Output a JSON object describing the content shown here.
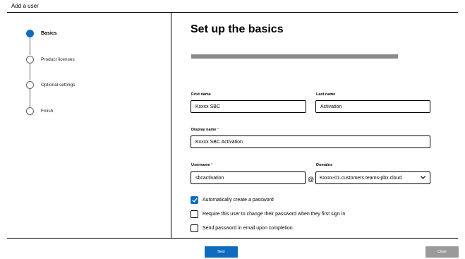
{
  "window": {
    "title": "Add a user"
  },
  "steps": [
    {
      "label": "Basics",
      "active": true
    },
    {
      "label": "Product licenses",
      "active": false
    },
    {
      "label": "Optional settings",
      "active": false
    },
    {
      "label": "Finish",
      "active": false
    }
  ],
  "main": {
    "heading": "Set up the basics",
    "first_name": {
      "label": "First name",
      "value": "Kxxxx SBC"
    },
    "last_name": {
      "label": "Last name",
      "value": "Activation"
    },
    "display_name": {
      "label": "Display name",
      "required_mark": "*",
      "value": "Kxxxx SBC Activation"
    },
    "username": {
      "label": "Username",
      "required_mark": "*",
      "value": "sbcactivation"
    },
    "at_sign": "@",
    "domains": {
      "label": "Domains",
      "selected": "Kxxxx-01.customers.teams-pbx.cloud"
    },
    "options": [
      {
        "label": "Automatically create a password",
        "checked": true
      },
      {
        "label": "Require this user to change their password when they first sign in",
        "checked": false
      },
      {
        "label": "Send password in email upon completion",
        "checked": false
      }
    ]
  },
  "footer": {
    "next_label": "Next",
    "close_label": "Close"
  },
  "colors": {
    "accent": "#0f6cbd",
    "required": "#c50f1f",
    "disabled": "#9a9a9a"
  },
  "icons": {
    "step_active": "filled-circle-icon",
    "step_inactive": "empty-circle-icon",
    "dropdown": "chevron-down-icon",
    "check": "checkmark-icon"
  }
}
